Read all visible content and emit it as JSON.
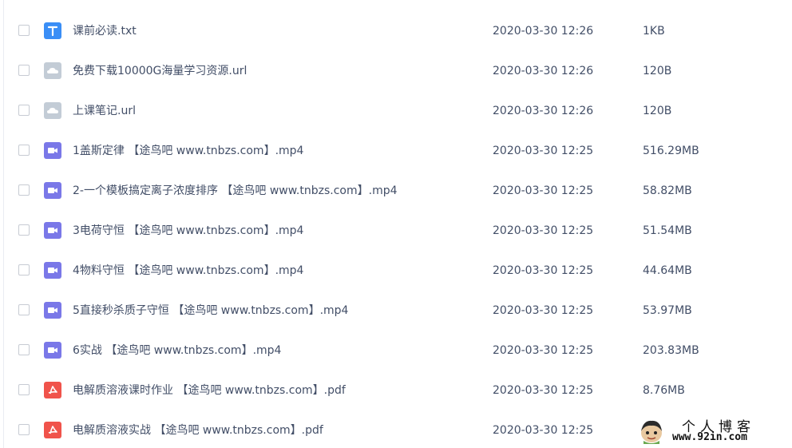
{
  "colors": {
    "text": "#424e67",
    "txt_icon": "#3a8ef6",
    "url_icon": "#c3ccd6",
    "video_icon": "#7a78e8",
    "pdf_icon": "#f0534b"
  },
  "files": [
    {
      "name": "课前必读.txt",
      "date": "2020-03-30 12:26",
      "size": "1KB",
      "type": "txt",
      "icon": "txt-file-icon"
    },
    {
      "name": "免费下载10000G海量学习资源.url",
      "date": "2020-03-30 12:26",
      "size": "120B",
      "type": "url",
      "icon": "url-file-icon"
    },
    {
      "name": "上课笔记.url",
      "date": "2020-03-30 12:26",
      "size": "120B",
      "type": "url",
      "icon": "url-file-icon"
    },
    {
      "name": "1盖斯定律 【途鸟吧 www.tnbzs.com】.mp4",
      "date": "2020-03-30 12:25",
      "size": "516.29MB",
      "type": "video",
      "icon": "video-file-icon"
    },
    {
      "name": "2-一个模板搞定离子浓度排序 【途鸟吧 www.tnbzs.com】.mp4",
      "date": "2020-03-30 12:25",
      "size": "58.82MB",
      "type": "video",
      "icon": "video-file-icon"
    },
    {
      "name": "3电荷守恒 【途鸟吧 www.tnbzs.com】.mp4",
      "date": "2020-03-30 12:25",
      "size": "51.54MB",
      "type": "video",
      "icon": "video-file-icon"
    },
    {
      "name": "4物料守恒 【途鸟吧 www.tnbzs.com】.mp4",
      "date": "2020-03-30 12:25",
      "size": "44.64MB",
      "type": "video",
      "icon": "video-file-icon"
    },
    {
      "name": "5直接秒杀质子守恒 【途鸟吧 www.tnbzs.com】.mp4",
      "date": "2020-03-30 12:25",
      "size": "53.97MB",
      "type": "video",
      "icon": "video-file-icon"
    },
    {
      "name": "6实战 【途鸟吧 www.tnbzs.com】.mp4",
      "date": "2020-03-30 12:25",
      "size": "203.83MB",
      "type": "video",
      "icon": "video-file-icon"
    },
    {
      "name": "电解质溶液课时作业 【途鸟吧 www.tnbzs.com】.pdf",
      "date": "2020-03-30 12:25",
      "size": "8.76MB",
      "type": "pdf",
      "icon": "pdf-file-icon"
    },
    {
      "name": "电解质溶液实战 【途鸟吧 www.tnbzs.com】.pdf",
      "date": "2020-03-30 12:25",
      "size": "",
      "type": "pdf",
      "icon": "pdf-file-icon"
    }
  ],
  "watermark": {
    "title": "个人博客",
    "url": "www.92in.com"
  }
}
